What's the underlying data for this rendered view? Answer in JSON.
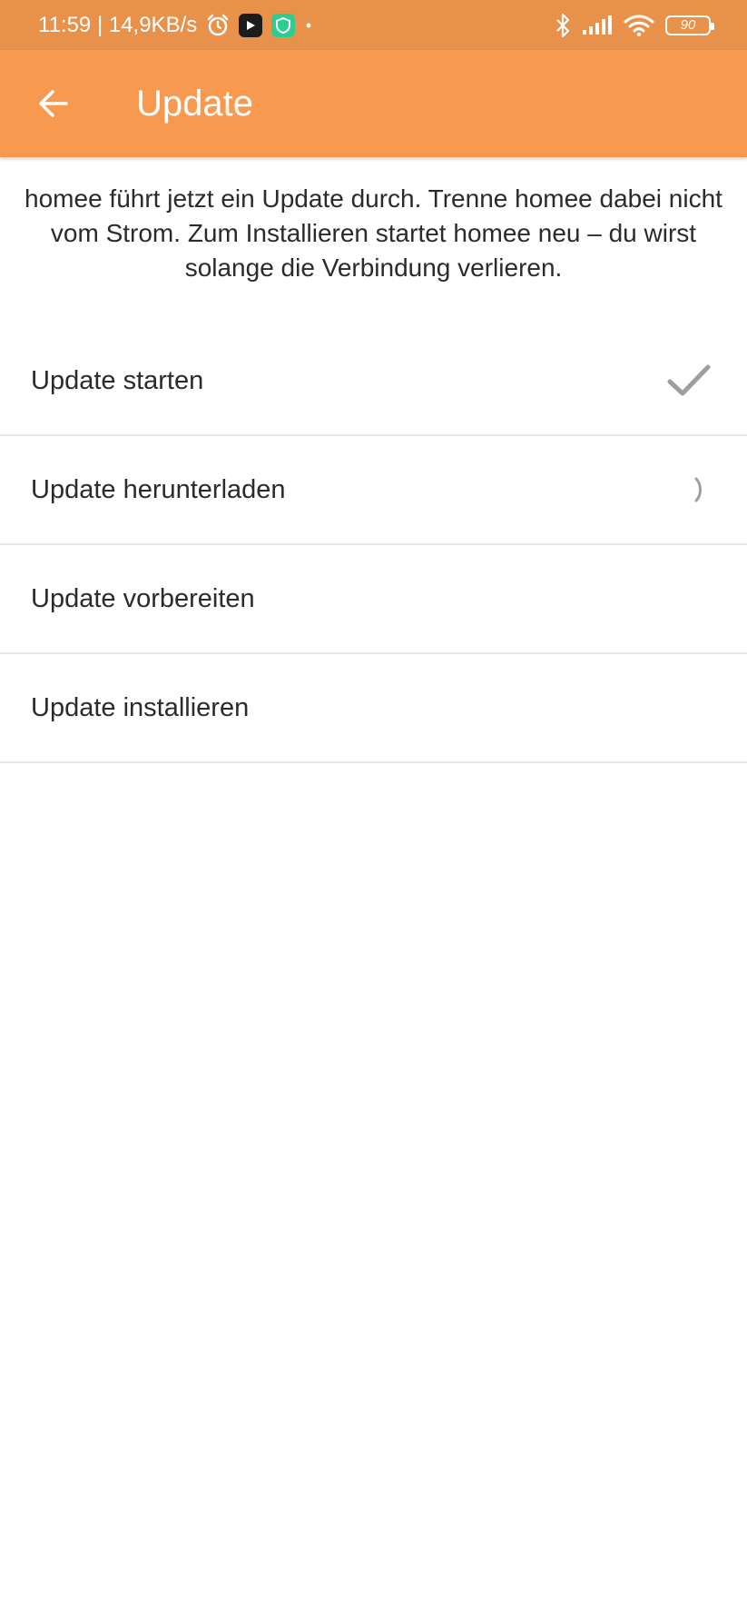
{
  "status_bar": {
    "time_speed": "11:59 | 14,9KB/s",
    "battery_level": "90",
    "icons": [
      "alarm-icon",
      "play-app-icon",
      "shield-app-icon",
      "dot-icon",
      "bluetooth-icon",
      "signal-icon",
      "wifi-icon",
      "battery-icon"
    ]
  },
  "app_bar": {
    "title": "Update",
    "back_icon": "arrow-left-icon"
  },
  "intro_text": "homee führt jetzt ein Update durch. Trenne homee dabei nicht vom Strom. Zum Installieren startet homee neu – du wirst solange die Verbindung verlieren.",
  "steps": [
    {
      "label": "Update starten",
      "status": "done"
    },
    {
      "label": "Update herunterladen",
      "status": "in-progress"
    },
    {
      "label": "Update vorbereiten",
      "status": "pending"
    },
    {
      "label": "Update installieren",
      "status": "pending"
    }
  ],
  "colors": {
    "status_bar": "#E8914A",
    "app_bar": "#F79A4F",
    "check": "#9e9e9e"
  }
}
